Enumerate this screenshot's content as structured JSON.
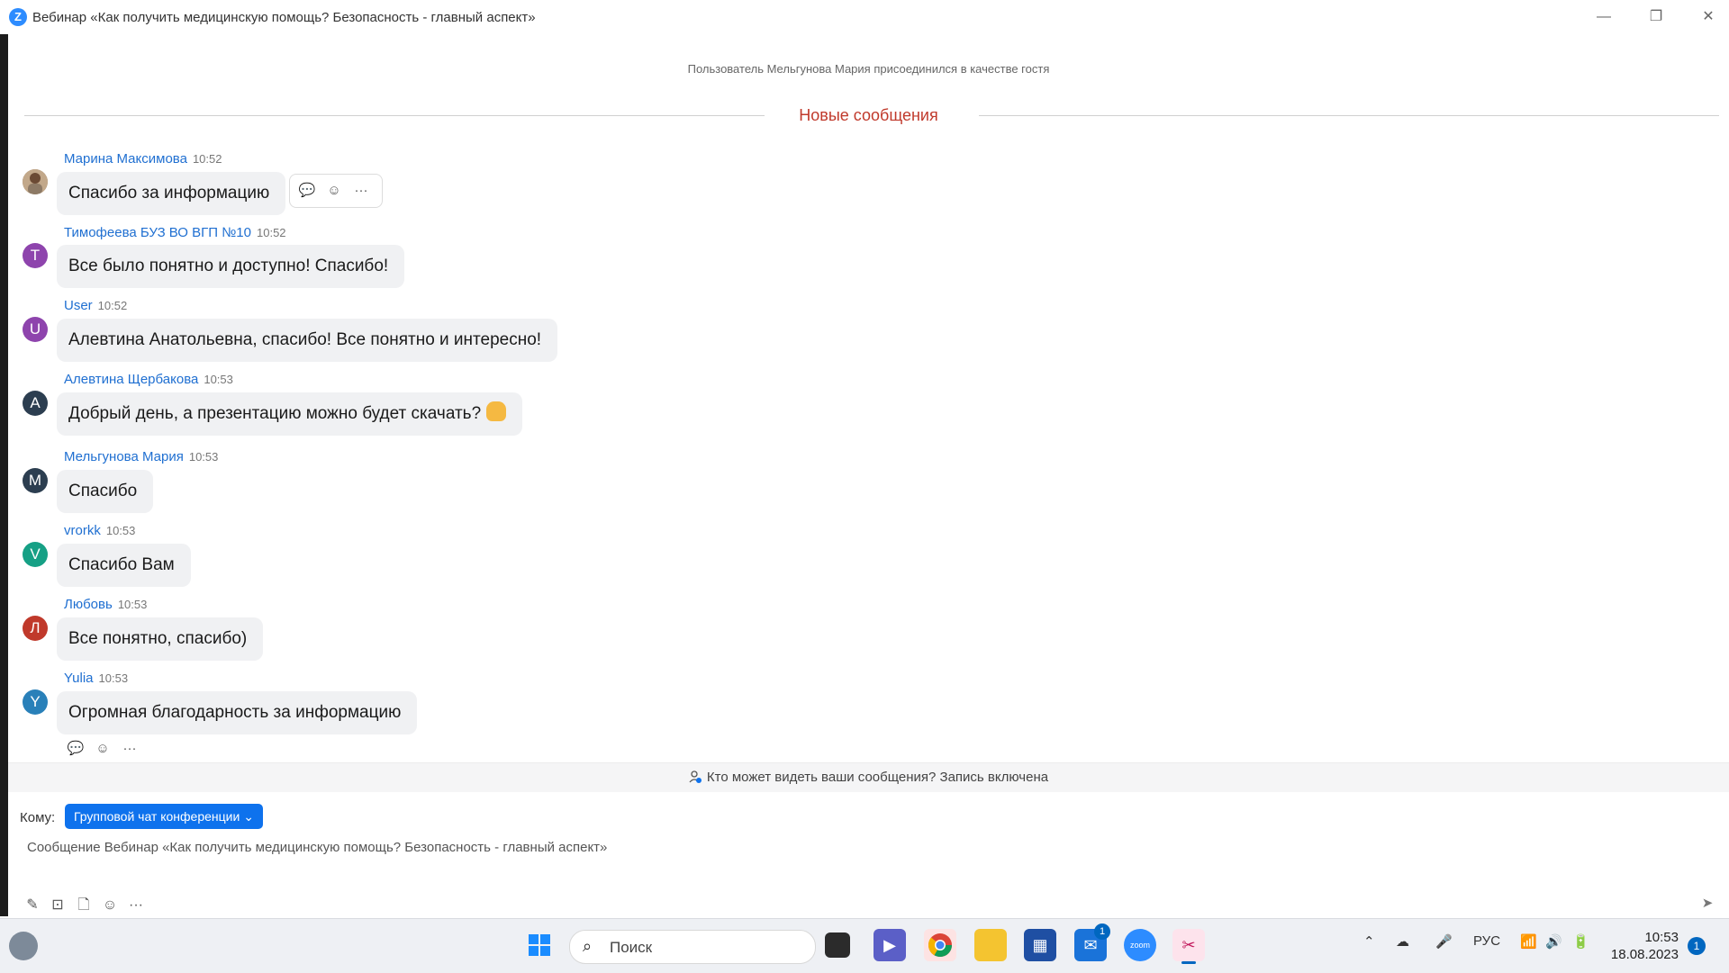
{
  "window": {
    "title": "Вебинар «Как получить медицинскую помощь? Безопасность - главный аспект»",
    "logo_letter": "Z",
    "controls": {
      "minimize": "—",
      "restore": "❐",
      "close": "✕"
    }
  },
  "chat": {
    "system_message": "Пользователь Мельгунова Мария присоединился в качестве гостя",
    "new_messages_label": "Новые сообщения",
    "messages": [
      {
        "sender": "Марина Максимова",
        "time": "10:52",
        "text": "Спасибо за информацию",
        "avatar_letter": "",
        "avatar_color": "#a58b74"
      },
      {
        "sender": "Тимофеева БУЗ ВО ВГП №10",
        "time": "10:52",
        "text": "Все было понятно и доступно! Спасибо!",
        "avatar_letter": "Т",
        "avatar_color": "#8e44ad"
      },
      {
        "sender": "User",
        "time": "10:52",
        "text": "Алевтина Анатольевна, спасибо! Все понятно и интересно!",
        "avatar_letter": "U",
        "avatar_color": "#8e44ad"
      },
      {
        "sender": "Алевтина Щербакова",
        "time": "10:53",
        "text": "Добрый день, а презентацию можно будет скачать?",
        "avatar_letter": "А",
        "avatar_color": "#2c3e50"
      },
      {
        "sender": "Мельгунова Мария",
        "time": "10:53",
        "text": "Спасибо",
        "avatar_letter": "М",
        "avatar_color": "#2c3e50"
      },
      {
        "sender": "vrorkk",
        "time": "10:53",
        "text": "Спасибо Вам",
        "avatar_letter": "V",
        "avatar_color": "#16a085"
      },
      {
        "sender": "Любовь",
        "time": "10:53",
        "text": "Все понятно, спасибо)",
        "avatar_letter": "Л",
        "avatar_color": "#c0392b"
      },
      {
        "sender": "Yulia",
        "time": "10:53",
        "text": "Огромная благодарность за информацию",
        "avatar_letter": "Y",
        "avatar_color": "#2980b9"
      }
    ],
    "action_icons": {
      "reply": "💬",
      "react": "☺",
      "more": "···"
    }
  },
  "recording_notice": "Кто может видеть ваши сообщения? Запись включена",
  "compose": {
    "to_label": "Кому:",
    "recipient": "Групповой чат конференции",
    "placeholder": "Сообщение Вебинар «Как получить медицинскую помощь? Безопасность - главный аспект»"
  },
  "taskbar": {
    "search_placeholder": "Поиск",
    "language": "РУС",
    "time": "10:53",
    "date": "18.08.2023",
    "notification_count": "1",
    "mail_badge": "1",
    "zoom_label": "zoom"
  },
  "colors": {
    "accent": "#0e72ed",
    "sender_name": "#1f6fd1",
    "new_messages": "#c0392b"
  }
}
